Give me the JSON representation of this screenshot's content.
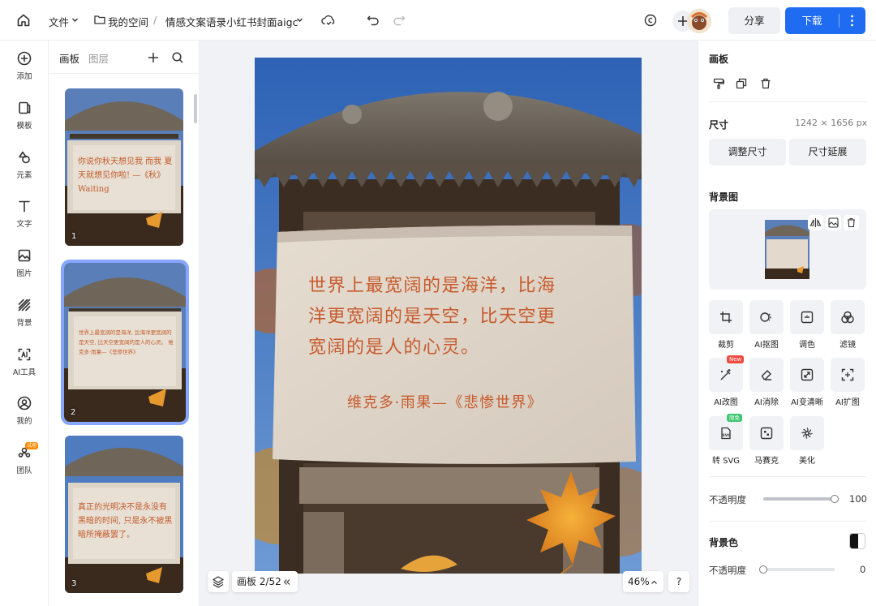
{
  "topbar": {
    "file_menu": "文件",
    "breadcrumb_space": "我的空间",
    "breadcrumb_sep": "/",
    "document_title": "情感文案语录小红书封面aigc",
    "share_label": "分享",
    "download_label": "下载"
  },
  "rail": {
    "items": [
      {
        "label": "添加",
        "icon": "plus-circle-icon"
      },
      {
        "label": "模板",
        "icon": "template-icon"
      },
      {
        "label": "元素",
        "icon": "shapes-icon"
      },
      {
        "label": "文字",
        "icon": "text-icon"
      },
      {
        "label": "图片",
        "icon": "image-icon"
      },
      {
        "label": "背景",
        "icon": "background-icon"
      },
      {
        "label": "AI工具",
        "icon": "ai-icon"
      },
      {
        "label": "我的",
        "icon": "user-icon"
      },
      {
        "label": "团队",
        "icon": "team-icon",
        "badge": "试用"
      }
    ]
  },
  "pages": {
    "tab_canvas": "画板",
    "tab_layers": "图层",
    "thumbs": [
      {
        "num": "1",
        "text": "你说你秋天想见我 而我 夏天就想见你啦! —《秋》Waiting"
      },
      {
        "num": "2",
        "text": "世界上最宽阔的是海洋, 比海洋更宽阔的是天空, 比天空更宽阔的是人的心灵。 维克多·雨果—《悲惨世界》"
      },
      {
        "num": "3",
        "text": "真正的光明决不是永没有黑暗的时间, 只是永不被黑暗所掩蔽罢了。"
      }
    ]
  },
  "artboard": {
    "quote_lines": [
      "世界上最宽阔的是海洋，比海",
      "洋更宽阔的是天空，比天空更",
      "宽阔的是人的心灵。"
    ],
    "author": "维克多·雨果—《悲惨世界》"
  },
  "bottom": {
    "page_indicator": "画板 2/52",
    "zoom": "46%",
    "help": "?"
  },
  "panel": {
    "section_canvas": "画板",
    "size_title": "尺寸",
    "size_value": "1242 × 1656 px",
    "resize_label": "调整尺寸",
    "extend_label": "尺寸延展",
    "bg_image_title": "背景图",
    "tools": [
      {
        "label": "裁剪",
        "icon": "crop-icon"
      },
      {
        "label": "AI抠图",
        "icon": "ai-cutout-icon"
      },
      {
        "label": "调色",
        "icon": "adjust-color-icon"
      },
      {
        "label": "滤镜",
        "icon": "filter-icon"
      },
      {
        "label": "AI改图",
        "icon": "ai-edit-icon",
        "badge": "New"
      },
      {
        "label": "AI消除",
        "icon": "eraser-icon"
      },
      {
        "label": "AI变清晰",
        "icon": "enhance-icon"
      },
      {
        "label": "AI扩图",
        "icon": "expand-icon"
      },
      {
        "label": "转 SVG",
        "icon": "svg-icon",
        "badge": "限免"
      },
      {
        "label": "马赛克",
        "icon": "mosaic-icon"
      },
      {
        "label": "美化",
        "icon": "beautify-icon"
      }
    ],
    "opacity_label": "不透明度",
    "opacity_value": "100",
    "opacity_fraction": 1.0,
    "bg_color_title": "背景色",
    "bg_opacity_label": "不透明度",
    "bg_opacity_value": "0",
    "bg_opacity_fraction": 0.0,
    "accent": "#1f6cf3"
  }
}
